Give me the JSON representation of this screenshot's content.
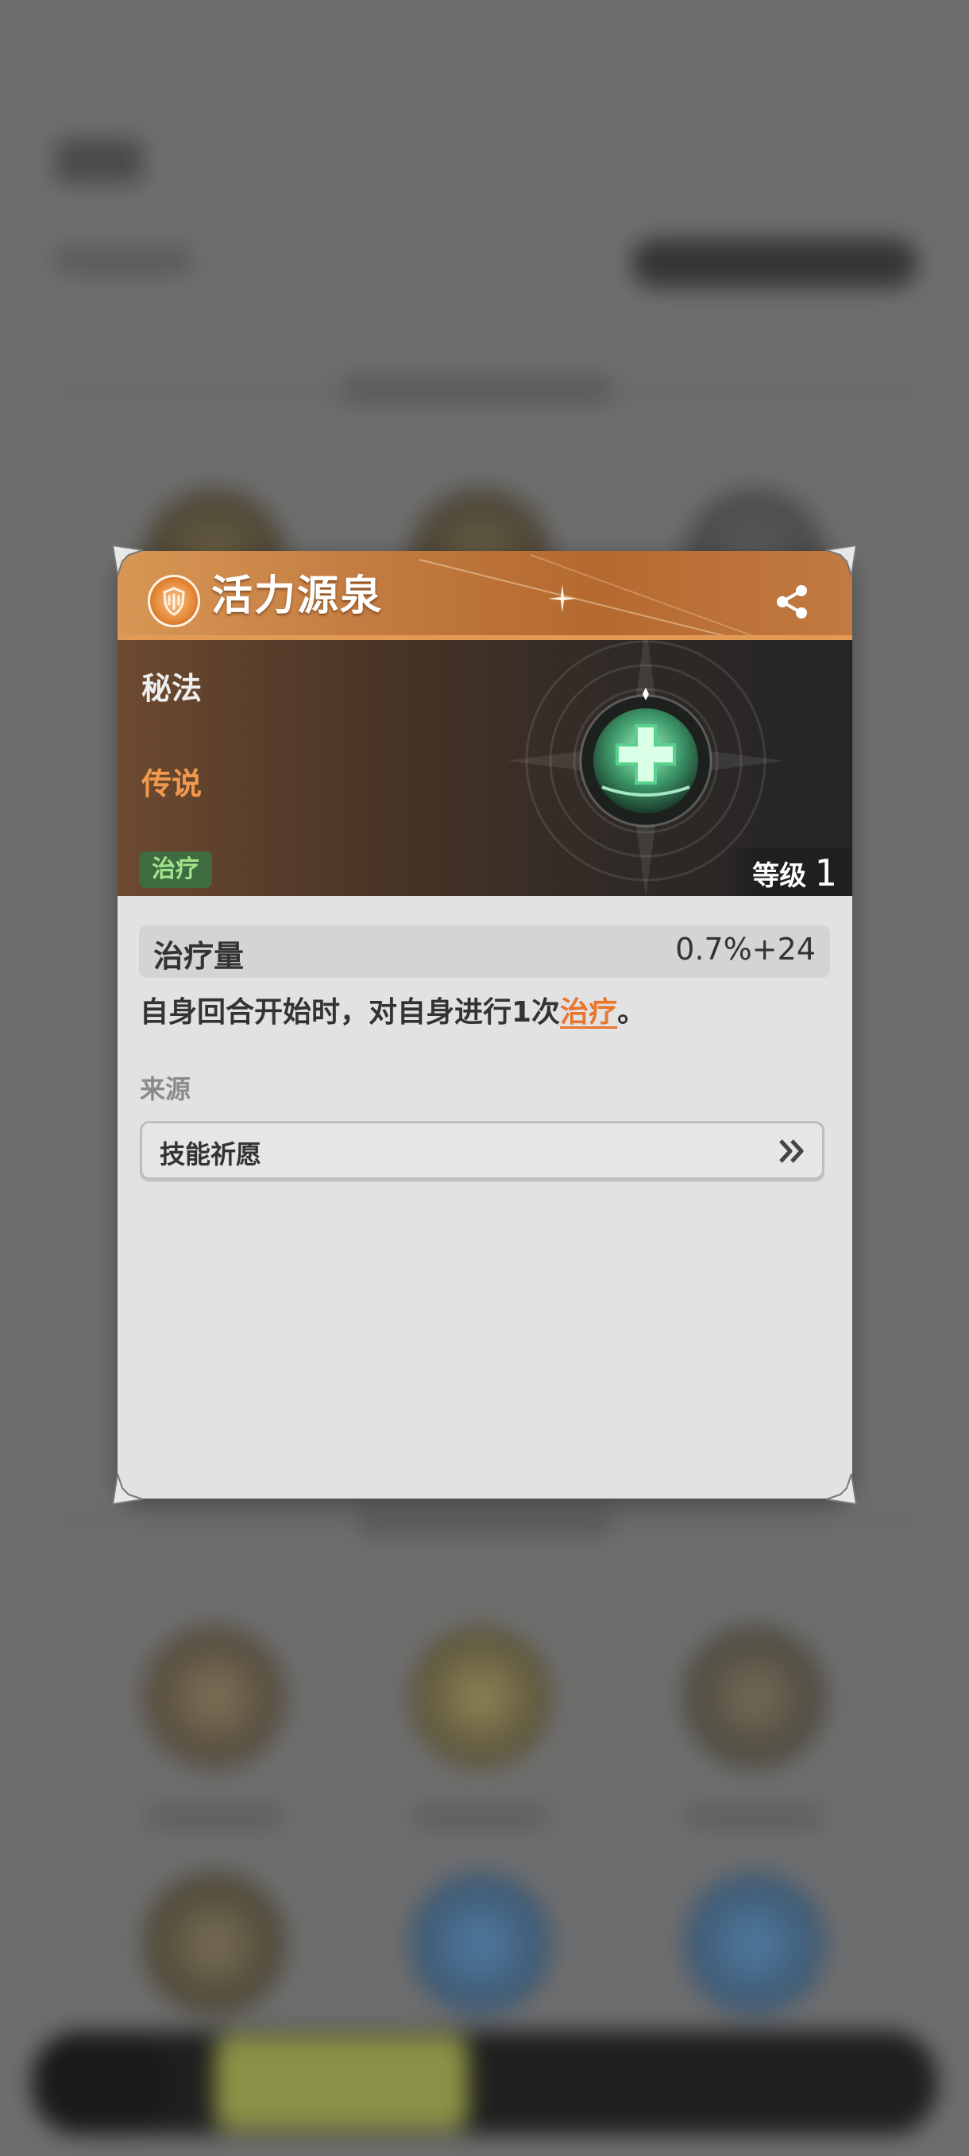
{
  "card": {
    "title": "活力源泉",
    "type": "秘法",
    "rarity": "传说",
    "tag": "治疗",
    "level_label": "等级",
    "level_value": "1",
    "stat": {
      "name": "治疗量",
      "value": "0.7%+24"
    },
    "description": {
      "before": "自身回合开始时，对自身进行1次",
      "keyword": "治疗",
      "after": "。"
    },
    "source_label": "来源",
    "source_item": "技能祈愿"
  },
  "icons": {
    "header": "shield-emblem-icon",
    "share": "share-icon",
    "skill": "healing-cross-icon",
    "source_arrow": "double-chevron-right-icon"
  },
  "colors": {
    "header_accent": "#c27b40",
    "rarity": "#f19a4f",
    "keyword": "#e8762f",
    "tag_bg": "#3f6b40",
    "tag_text": "#9fe38a"
  }
}
